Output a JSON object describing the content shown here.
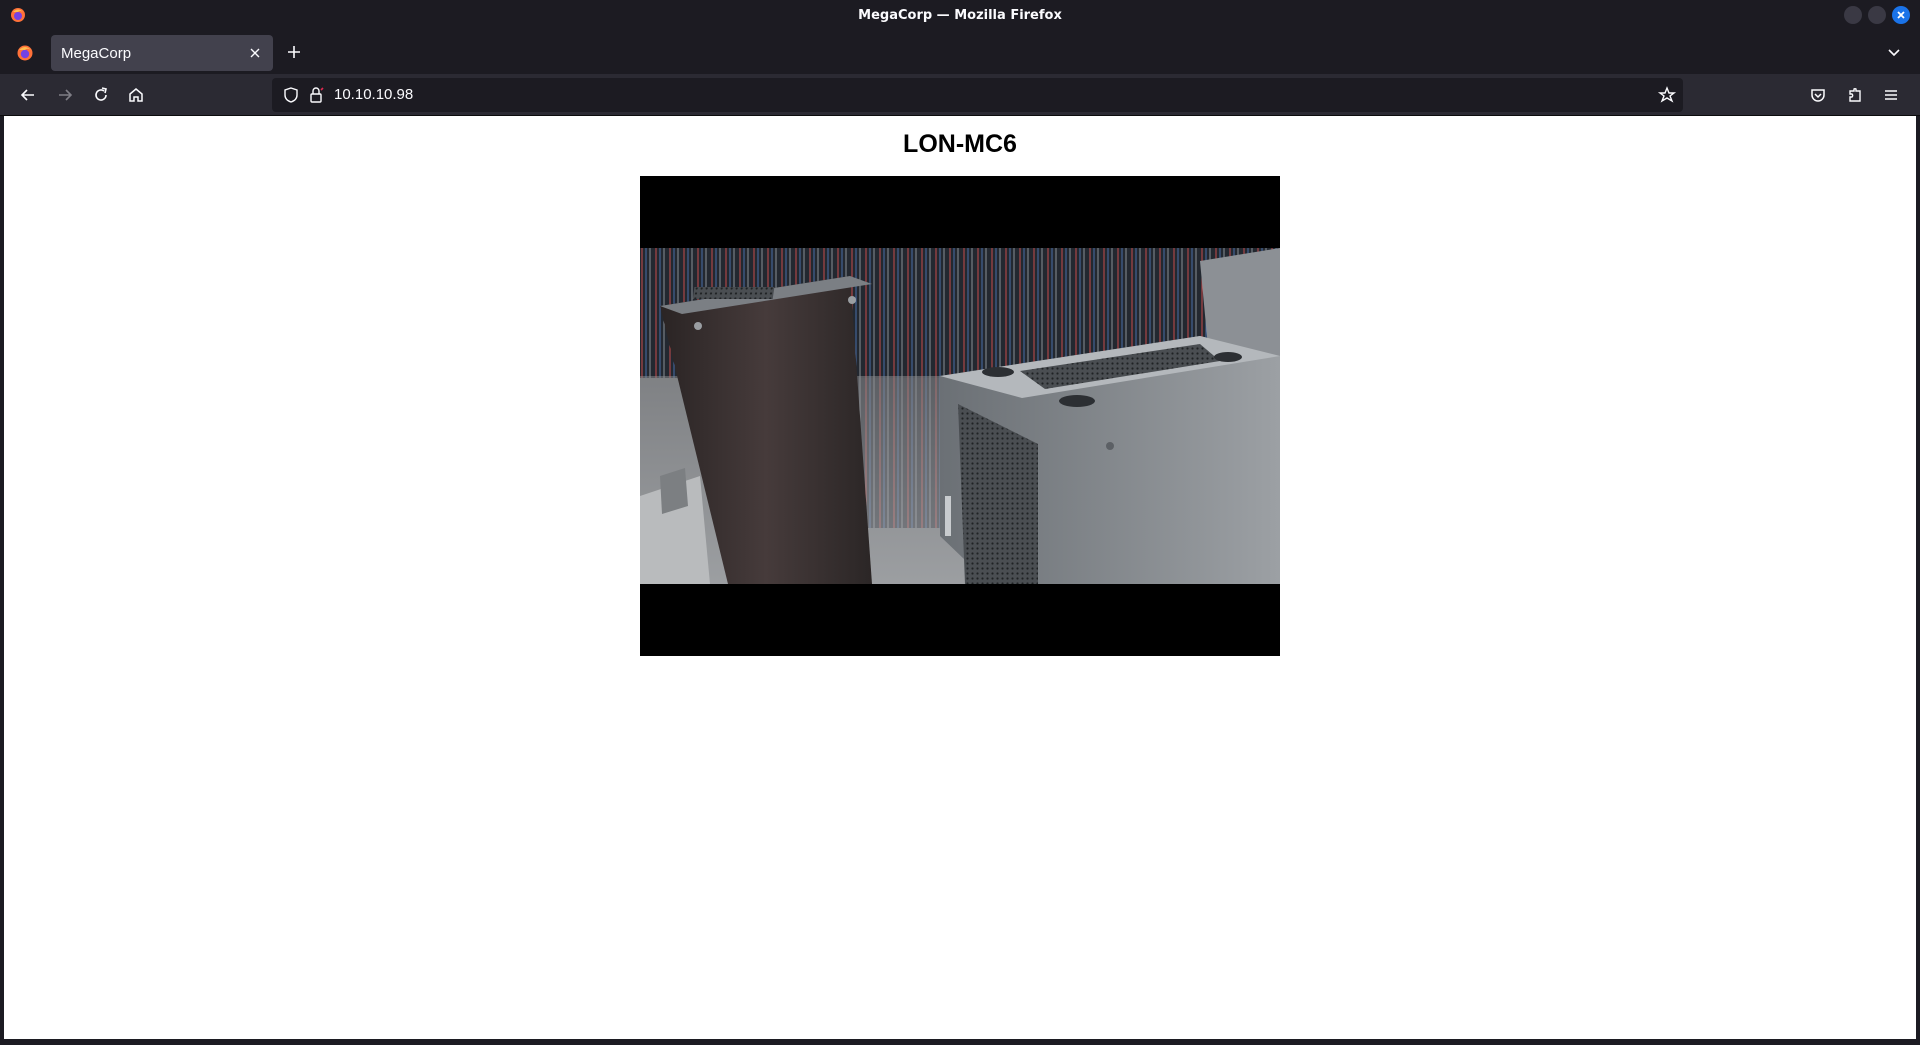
{
  "window": {
    "title": "MegaCorp — Mozilla Firefox"
  },
  "tabs": [
    {
      "title": "MegaCorp",
      "active": true
    }
  ],
  "navbar": {
    "url": "10.10.10.98"
  },
  "page": {
    "heading": "LON-MC6"
  },
  "colors": {
    "chrome_bg": "#1c1b22",
    "toolbar_bg": "#2b2a33",
    "tab_active_bg": "#42414d",
    "close_button": "#1a73e8",
    "page_bg": "#ffffff"
  },
  "icons": {
    "app": "firefox-icon",
    "back": "back-arrow-icon",
    "forward": "forward-arrow-icon",
    "reload": "reload-icon",
    "home": "home-icon",
    "tracking": "shield-icon",
    "security": "lock-icon",
    "bookmark": "star-icon",
    "pocket": "pocket-icon",
    "extensions": "puzzle-icon",
    "menu": "hamburger-menu-icon"
  }
}
